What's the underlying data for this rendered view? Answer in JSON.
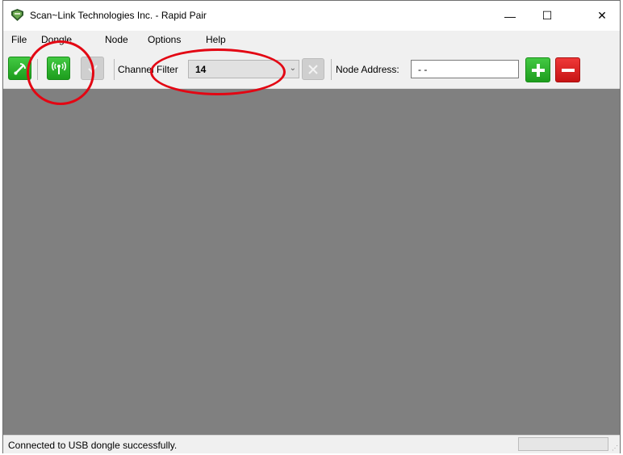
{
  "window": {
    "title": "Scan~Link Technologies Inc. - Rapid Pair",
    "controls": {
      "minimize": "—",
      "maximize": "☐",
      "close": "✕"
    }
  },
  "menu": [
    "File",
    "Dongle",
    "Node",
    "Options",
    "Help"
  ],
  "toolbar": {
    "channel_filter_label": "Channel Filter",
    "channel_filter_value": "14",
    "node_address_label": "Node Address:",
    "node_address_value": "- -",
    "icons": {
      "connect": "antenna-wave-icon",
      "signal": "radio-signal-icon",
      "confirm": "check-icon",
      "clear": "x-icon",
      "add": "plus-icon",
      "remove": "minus-icon"
    }
  },
  "status": {
    "message": "Connected to USB dongle successfully."
  },
  "colors": {
    "green": "#1d9d1d",
    "red": "#c71414",
    "annotation": "#e30613",
    "workspace": "#808080"
  }
}
